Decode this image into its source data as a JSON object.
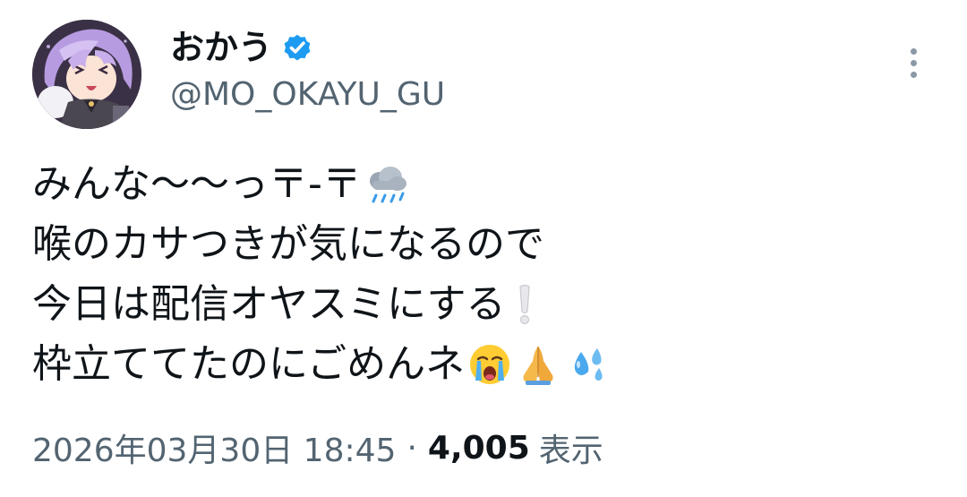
{
  "author": {
    "display_name": "おかう",
    "handle": "@MO_OKAYU_GU",
    "verified": true
  },
  "tweet": {
    "lines": [
      "みんな〜〜っ〒-〒",
      "喉のカサつきが気になるので",
      "今日は配信オヤスミにする",
      "枠立ててたのにごめんネ"
    ]
  },
  "meta": {
    "timestamp": "2026年03月30日 18:45",
    "separator": "·",
    "view_count": "4,005",
    "view_label": "表示"
  },
  "icons": {
    "verified": "verified-badge-icon",
    "more": "more-vertical-icon",
    "emoji_line1": "cloud-with-rain-icon",
    "emoji_line3": "white-exclamation-icon",
    "emoji_line4": [
      "loudly-crying-face-icon",
      "folded-hands-icon",
      "sweat-droplets-icon"
    ]
  },
  "colors": {
    "text": "#0f1419",
    "secondary": "#536471",
    "verified": "#1d9bf0"
  }
}
